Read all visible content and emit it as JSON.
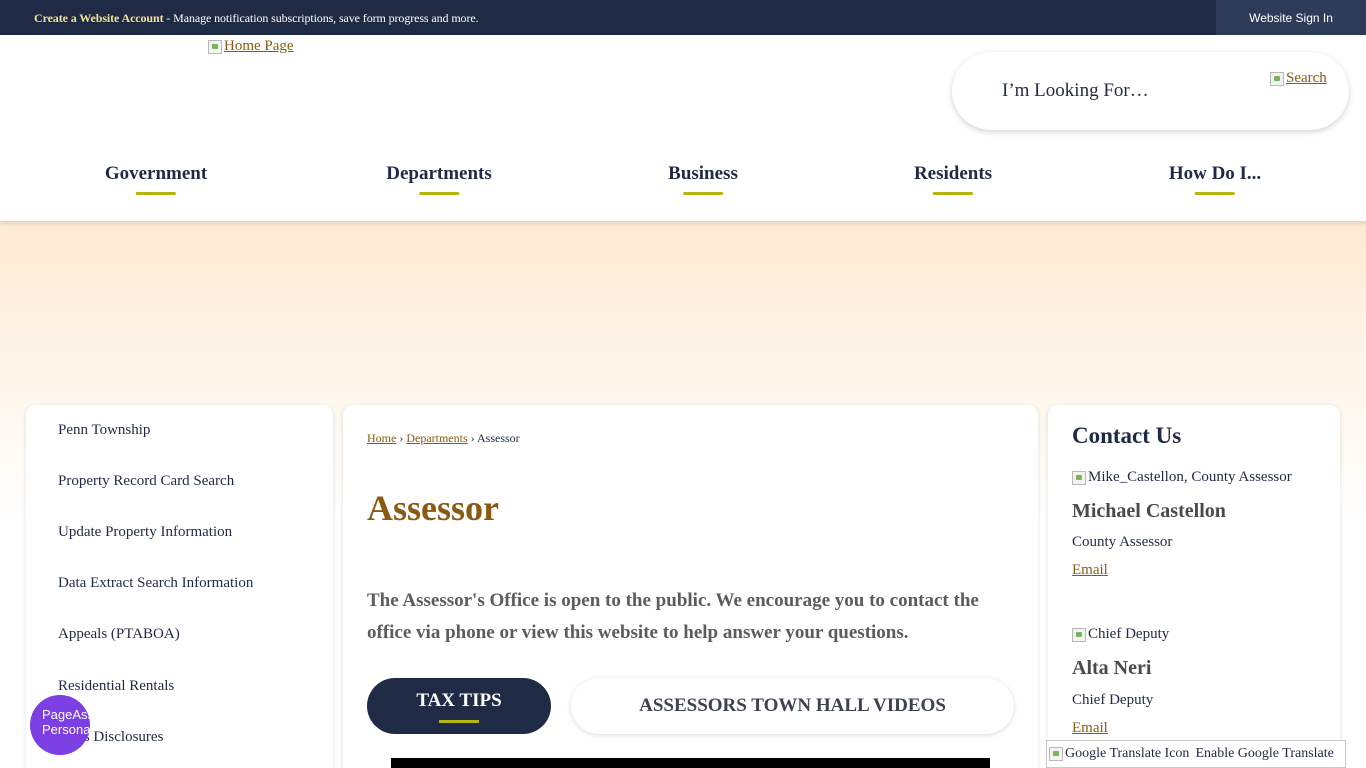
{
  "topbar": {
    "create_account_label": "Create a Website Account",
    "create_account_desc": " - Manage notification subscriptions, save form progress and more.",
    "signin_label": "Website Sign In"
  },
  "header": {
    "logo_alt": "Home Page",
    "search_placeholder": "I’m Looking For…",
    "search_button_alt": "Search"
  },
  "nav": {
    "items": [
      {
        "label": "Government"
      },
      {
        "label": "Departments"
      },
      {
        "label": "Business"
      },
      {
        "label": "Residents"
      },
      {
        "label": "How Do I..."
      }
    ]
  },
  "sidebar": {
    "items": [
      {
        "label": "Penn Township"
      },
      {
        "label": "Property Record Card Search"
      },
      {
        "label": "Update Property Information"
      },
      {
        "label": "Data Extract Search Information"
      },
      {
        "label": "Appeals (PTABOA)"
      },
      {
        "label": "Residential Rentals"
      },
      {
        "label": "Sales Disclosures"
      }
    ]
  },
  "main": {
    "breadcrumb": {
      "home": "Home",
      "sep1": " › ",
      "departments": "Departments",
      "sep2": " › ",
      "current": "Assessor"
    },
    "title": "Assessor",
    "intro": "The Assessor's Office is open to the public. We encourage you to contact the office via phone or view this website to help answer your questions.",
    "tabs": [
      {
        "label": "TAX TIPS",
        "active": true
      },
      {
        "label": "ASSESSORS TOWN HALL VIDEOS",
        "active": false
      }
    ]
  },
  "contact": {
    "heading": "Contact Us",
    "people": [
      {
        "img_alt": "Mike_Castellon, County Assessor",
        "name": "Michael Castellon",
        "role": "County Assessor",
        "email_label": "Email"
      },
      {
        "img_alt": "Chief Deputy",
        "name": "Alta Neri",
        "role": "Chief Deputy",
        "email_label": "Email"
      }
    ]
  },
  "widgets": {
    "accessibility_alt": "PageAssist Personalization",
    "translate_alt": "Google Translate Icon",
    "translate_label": "Enable Google Translate"
  },
  "colors": {
    "navy": "#1f2a44",
    "accent_gold": "#b5b512",
    "link_brown": "#8a5a12",
    "accessibility_purple": "#7b3fe4"
  }
}
